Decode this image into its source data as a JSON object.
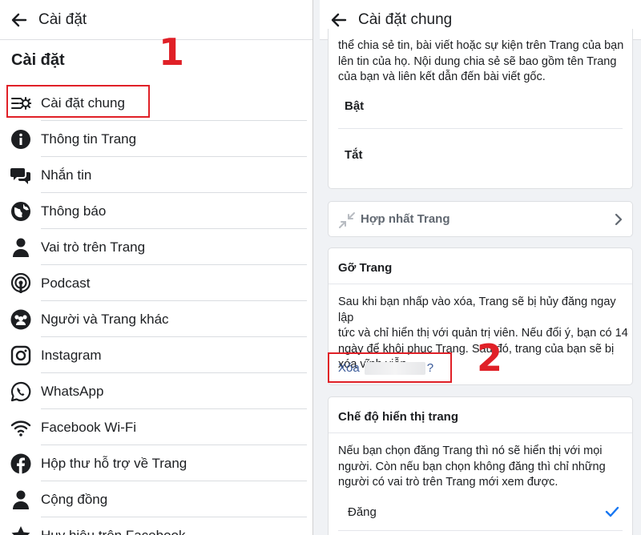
{
  "left_panel": {
    "title": "Cài đặt",
    "heading": "Cài đặt",
    "items": [
      {
        "label": "Cài đặt chung",
        "icon": "settings-list-icon"
      },
      {
        "label": "Thông tin Trang",
        "icon": "info-icon"
      },
      {
        "label": "Nhắn tin",
        "icon": "chat-icon"
      },
      {
        "label": "Thông báo",
        "icon": "globe-icon"
      },
      {
        "label": "Vai trò trên Trang",
        "icon": "person-icon"
      },
      {
        "label": "Podcast",
        "icon": "podcast-icon"
      },
      {
        "label": "Người và Trang khác",
        "icon": "people-icon"
      },
      {
        "label": "Instagram",
        "icon": "instagram-icon"
      },
      {
        "label": "WhatsApp",
        "icon": "whatsapp-icon"
      },
      {
        "label": "Facebook Wi-Fi",
        "icon": "wifi-icon"
      },
      {
        "label": "Hộp thư hỗ trợ về Trang",
        "icon": "facebook-icon"
      },
      {
        "label": "Cộng đồng",
        "icon": "person-icon"
      },
      {
        "label": "Huy hiệu trên Facebook",
        "icon": "badge-icon"
      }
    ]
  },
  "right_panel": {
    "title": "Cài đặt chung",
    "share_text": [
      "thể chia sẻ tin, bài viết hoặc sự kiện trên Trang của bạn",
      "lên tin của họ. Nội dung chia sẻ sẽ bao gồm tên Trang",
      "của bạn và liên kết dẫn đến bài viết gốc."
    ],
    "option_on": "Bật",
    "option_off": "Tắt",
    "merge_label": "Hợp nhất Trang",
    "remove_title": "Gỡ Trang",
    "remove_text": [
      "Sau khi bạn nhấp vào xóa, Trang sẽ bị hủy đăng ngay lập",
      "tức và chỉ hiển thị với quản trị viên. Nếu đổi ý, bạn có 14",
      "ngày để khôi phục Trang. Sau đó, trang của bạn sẽ bị",
      "xóa vĩnh viễn."
    ],
    "delete_link_prefix": "Xóa",
    "delete_link_suffix": "?",
    "visibility_title": "Chế độ hiển thị trang",
    "visibility_text": [
      "Nếu bạn chọn đăng Trang thì nó sẽ hiển thị với mọi",
      "người. Còn nếu bạn chọn không đăng thì chỉ những",
      "người có vai trò trên Trang mới xem được."
    ],
    "publish_label": "Đăng"
  },
  "annotations": {
    "step1": "1",
    "step2": "2"
  },
  "colors": {
    "highlight": "#e02027",
    "link": "#385898",
    "check": "#1877f2"
  }
}
